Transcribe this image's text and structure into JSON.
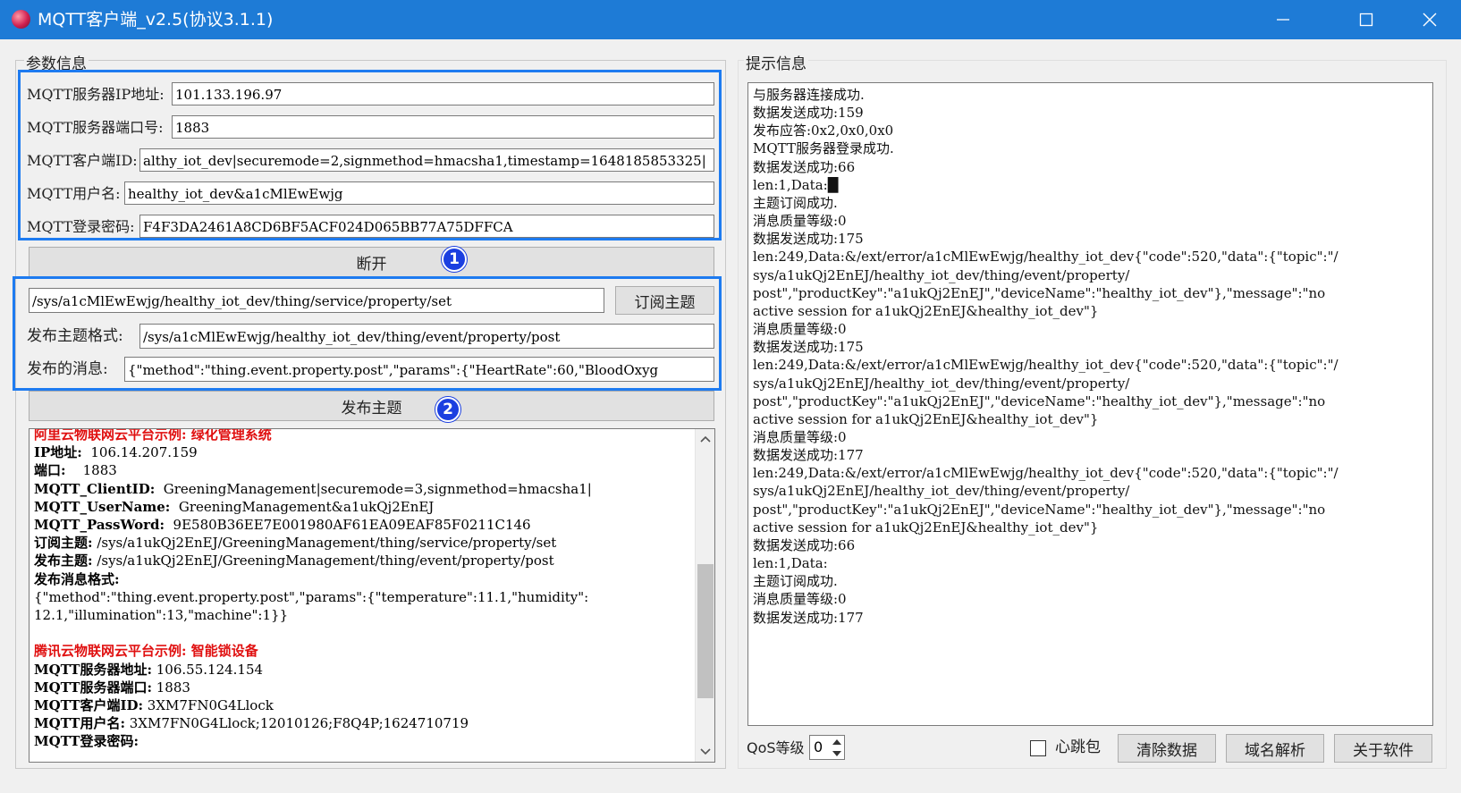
{
  "window": {
    "title": "MQTT客户端_v2.5(协议3.1.1)"
  },
  "params_group": {
    "label": "参数信息",
    "server_ip_label": "MQTT服务器IP地址:",
    "server_ip_value": "101.133.196.97",
    "server_port_label": "MQTT服务器端口号:",
    "server_port_value": "1883",
    "client_id_label": "MQTT客户端ID:",
    "client_id_value": "althy_iot_dev|securemode=2,signmethod=hmacsha1,timestamp=1648185853325|",
    "username_label": "MQTT用户名:",
    "username_value": "healthy_iot_dev&a1cMlEwEwjg",
    "password_label": "MQTT登录密码:",
    "password_value": "F4F3DA2461A8CD6BF5ACF024D065BB77A75DFFCA",
    "disconnect_label": "断开",
    "badge1": "1",
    "subscribe_topic_value": "/sys/a1cMlEwEwjg/healthy_iot_dev/thing/service/property/set",
    "subscribe_button_label": "订阅主题",
    "publish_format_label": "发布主题格式:",
    "publish_format_value": "/sys/a1cMlEwEwjg/healthy_iot_dev/thing/event/property/post",
    "publish_msg_label": "发布的消息:",
    "publish_msg_value": "{\"method\":\"thing.event.property.post\",\"params\":{\"HeartRate\":60,\"BloodOxyg",
    "publish_button_label": "发布主题",
    "badge2": "2"
  },
  "examples": {
    "aliyun_title": "阿里云物联网云平台示例: 绿化管理系统",
    "ip_key": "IP地址:",
    "ip_val": "  106.14.207.159",
    "port_key": "端口:",
    "port_val": "    1883",
    "clientid_key": "MQTT_ClientID:",
    "clientid_val": "  GreeningManagement|securemode=3,signmethod=hmacsha1|",
    "username_key": "MQTT_UserName:",
    "username_val": "  GreeningManagement&a1ukQj2EnEJ",
    "password_key": "MQTT_PassWord:",
    "password_val": "  9E580B36EE7E001980AF61EA09EAF85F0211C146",
    "sub_key": "订阅主题:",
    "sub_val": " /sys/a1ukQj2EnEJ/GreeningManagement/thing/service/property/set",
    "pub_key": "发布主题:",
    "pub_val": " /sys/a1ukQj2EnEJ/GreeningManagement/thing/event/property/post",
    "format_key": "发布消息格式:",
    "format_line1": "{\"method\":\"thing.event.property.post\",\"params\":{\"temperature\":11.1,\"humidity\":",
    "format_line2": "12.1,\"illumination\":13,\"machine\":1}}",
    "tencent_title": "腾讯云物联网云平台示例: 智能锁设备",
    "t_addr_key": "MQTT服务器地址:",
    "t_addr_val": " 106.55.124.154",
    "t_port_key": "MQTT服务器端口:",
    "t_port_val": " 1883",
    "t_cid_key": "MQTT客户端ID:",
    "t_cid_val": " 3XM7FN0G4Llock",
    "t_user_key": "MQTT用户名:",
    "t_user_val": " 3XM7FN0G4Llock;12010126;F8Q4P;1624710719",
    "t_pwd_key": "MQTT登录密码:"
  },
  "tips_group": {
    "label": "提示信息",
    "log_lines": [
      "与服务器连接成功.",
      "数据发送成功:159",
      "发布应答:0x2,0x0,0x0",
      "MQTT服务器登录成功.",
      "数据发送成功:66",
      "len:1,Data:█",
      "主题订阅成功.",
      "消息质量等级:0",
      "数据发送成功:175",
      "len:249,Data:&/ext/error/a1cMlEwEwjg/healthy_iot_dev{\"code\":520,\"data\":{\"topic\":\"/",
      "sys/a1ukQj2EnEJ/healthy_iot_dev/thing/event/property/",
      "post\",\"productKey\":\"a1ukQj2EnEJ\",\"deviceName\":\"healthy_iot_dev\"},\"message\":\"no",
      "active session for a1ukQj2EnEJ&healthy_iot_dev\"}",
      "消息质量等级:0",
      "数据发送成功:175",
      "len:249,Data:&/ext/error/a1cMlEwEwjg/healthy_iot_dev{\"code\":520,\"data\":{\"topic\":\"/",
      "sys/a1ukQj2EnEJ/healthy_iot_dev/thing/event/property/",
      "post\",\"productKey\":\"a1ukQj2EnEJ\",\"deviceName\":\"healthy_iot_dev\"},\"message\":\"no",
      "active session for a1ukQj2EnEJ&healthy_iot_dev\"}",
      "消息质量等级:0",
      "数据发送成功:177",
      "len:249,Data:&/ext/error/a1cMlEwEwjg/healthy_iot_dev{\"code\":520,\"data\":{\"topic\":\"/",
      "sys/a1ukQj2EnEJ/healthy_iot_dev/thing/event/property/",
      "post\",\"productKey\":\"a1ukQj2EnEJ\",\"deviceName\":\"healthy_iot_dev\"},\"message\":\"no",
      "active session for a1ukQj2EnEJ&healthy_iot_dev\"}",
      "数据发送成功:66",
      "len:1,Data:",
      "主题订阅成功.",
      "消息质量等级:0",
      "数据发送成功:177"
    ],
    "qos_label": "QoS等级",
    "qos_value": "0",
    "heartbeat_label": "心跳包",
    "heartbeat_checked": false,
    "clear_button": "清除数据",
    "dns_button": "域名解析",
    "about_button": "关于软件"
  }
}
